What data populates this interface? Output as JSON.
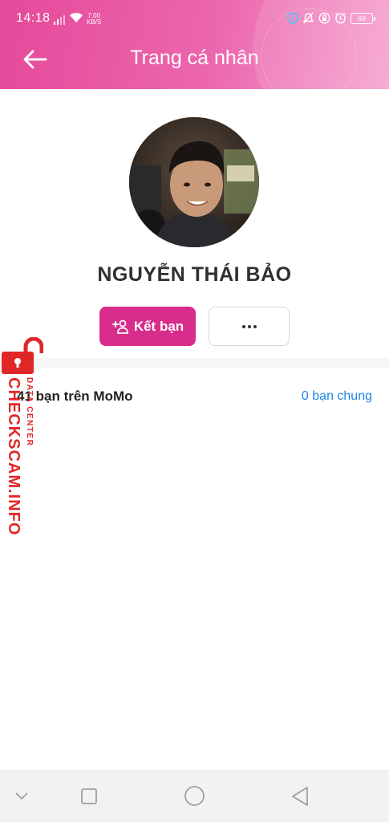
{
  "status_bar": {
    "time": "14:18",
    "net_speed_value": "7.00",
    "net_speed_unit": "KB/S",
    "battery": "69"
  },
  "header": {
    "title": "Trang cá nhân"
  },
  "profile": {
    "name": "NGUYỄN THÁI BẢO"
  },
  "actions": {
    "add_friend_label": "Kết bạn"
  },
  "friends": {
    "count_text": "41 bạn trên MoMo",
    "mutual_text": "0 bạn chung"
  },
  "watermark": {
    "main": "CHECKSCAM.INFO",
    "sub": "DATA CENTER"
  },
  "colors": {
    "brand": "#d82d8b",
    "link": "#1e88e5",
    "watermark": "#e02727"
  }
}
